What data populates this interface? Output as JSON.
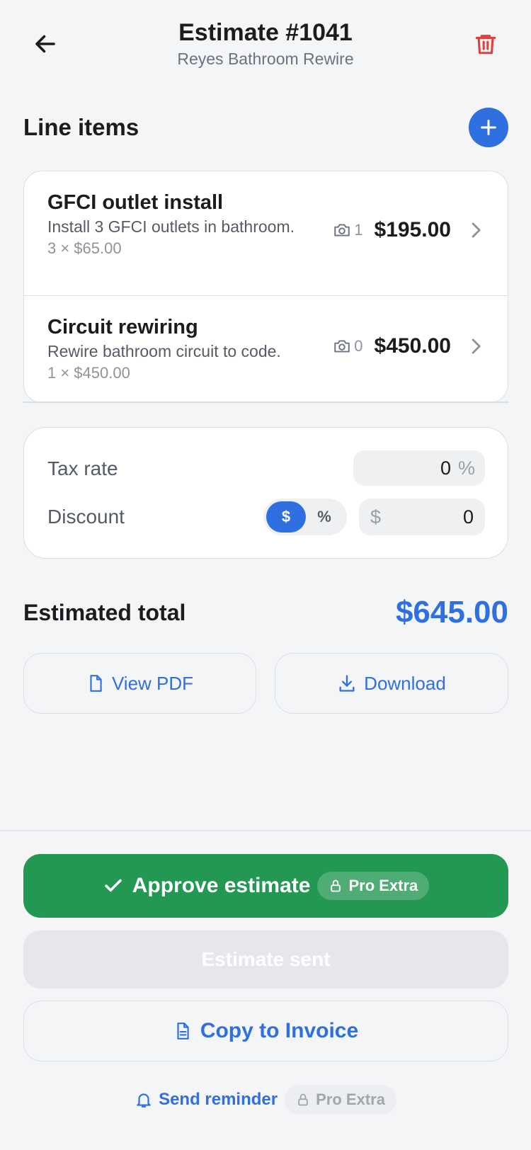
{
  "header": {
    "title": "Estimate #1041",
    "subtitle": "Reyes Bathroom Rewire",
    "back_icon": "arrow-left-icon",
    "delete_icon": "trash-icon"
  },
  "line_items": {
    "section_title": "Line items",
    "items": [
      {
        "name": "GFCI outlet install",
        "description": "Install 3 GFCI outlets in bathroom.",
        "quantity_line": "3 × $65.00",
        "photo_count": "1",
        "price": "$195.00"
      },
      {
        "name": "Circuit rewiring",
        "description": "Rewire bathroom circuit to code.",
        "quantity_line": "1 × $450.00",
        "photo_count": "0",
        "price": "$450.00"
      }
    ]
  },
  "adjustments": {
    "tax_label": "Tax rate",
    "tax_value": "0",
    "tax_unit": "%",
    "discount_label": "Discount",
    "discount_mode_dollar": "$",
    "discount_mode_percent": "%",
    "discount_currency": "$",
    "discount_value": "0"
  },
  "total": {
    "label": "Estimated total",
    "value": "$645.00"
  },
  "actions": {
    "view_pdf": "View PDF",
    "download": "Download",
    "approve": "Approve estimate",
    "pro_badge": "Pro Extra",
    "estimate_sent": "Estimate sent",
    "copy_to_invoice": "Copy to Invoice",
    "send_reminder": "Send reminder",
    "reminder_badge": "Pro Extra"
  },
  "colors": {
    "accent": "#2f6fe0",
    "approve": "#229852",
    "danger": "#e0413a",
    "background": "#f4f5f7"
  }
}
